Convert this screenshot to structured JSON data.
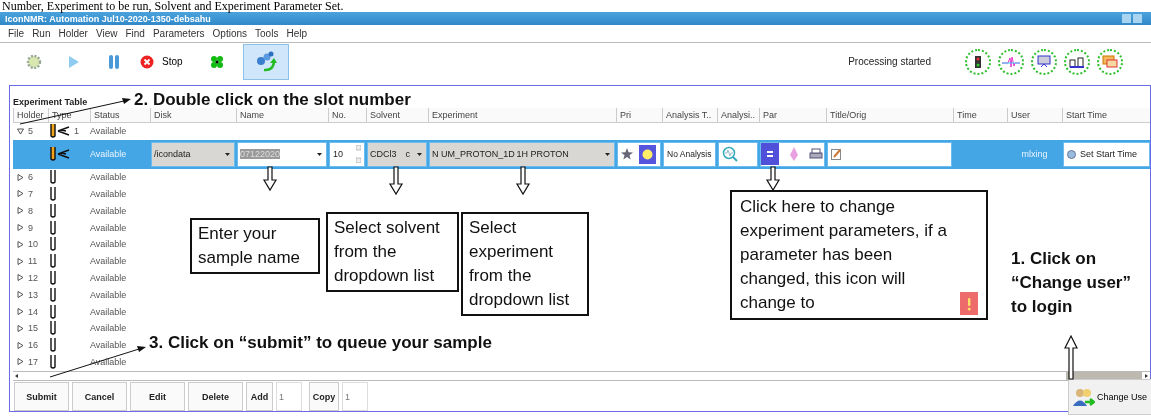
{
  "caption": "Number, Experiment to be run, Solvent and Experiment Parameter Set.",
  "window": {
    "title": "IconNMR: Automation Jul10-2020-1350-debsahu"
  },
  "menu": [
    "File",
    "Run",
    "Holder",
    "View",
    "Find",
    "Parameters",
    "Options",
    "Tools",
    "Help"
  ],
  "toolbar": {
    "stop_label": "Stop",
    "status": "Processing started"
  },
  "table": {
    "title": "Experiment Table",
    "columns": [
      "Holder",
      "Type",
      "Status",
      "Disk",
      "Name",
      "No.",
      "Solvent",
      "Experiment",
      "Pri",
      "Analysis T..",
      "Analysi..",
      "Par",
      "Title/Orig",
      "Time",
      "User",
      "Start Time"
    ],
    "rows": [
      {
        "holder": "5",
        "expanded": true,
        "loaded": true,
        "count": "1",
        "status": "Available"
      },
      {
        "holder": "6",
        "expanded": false,
        "loaded": false,
        "status": "Available"
      },
      {
        "holder": "7",
        "expanded": false,
        "loaded": false,
        "status": "Available"
      },
      {
        "holder": "8",
        "expanded": false,
        "loaded": false,
        "status": "Available"
      },
      {
        "holder": "9",
        "expanded": false,
        "loaded": false,
        "status": "Available"
      },
      {
        "holder": "10",
        "expanded": false,
        "loaded": false,
        "status": "Available"
      },
      {
        "holder": "11",
        "expanded": false,
        "loaded": false,
        "status": "Available"
      },
      {
        "holder": "12",
        "expanded": false,
        "loaded": false,
        "status": "Available"
      },
      {
        "holder": "13",
        "expanded": false,
        "loaded": false,
        "status": "Available"
      },
      {
        "holder": "14",
        "expanded": false,
        "loaded": false,
        "status": "Available"
      },
      {
        "holder": "15",
        "expanded": false,
        "loaded": false,
        "status": "Available"
      },
      {
        "holder": "16",
        "expanded": false,
        "loaded": false,
        "status": "Available"
      },
      {
        "holder": "17",
        "expanded": false,
        "loaded": false,
        "status": "Available"
      }
    ],
    "entry": {
      "status": "Available",
      "disk": "/icondata",
      "name": "07122020",
      "number": "10",
      "solvent": "CDCl3",
      "solvent_code": "c",
      "experiment": "N UM_PROTON_1D",
      "experiment_title": "1H PROTON",
      "analysis": "No Analysis",
      "user": "mlxing",
      "start_time_button": "Set Start Time"
    }
  },
  "buttons": [
    {
      "label": "Submit"
    },
    {
      "label": "Cancel"
    },
    {
      "label": "Edit"
    },
    {
      "label": "Delete"
    }
  ],
  "add": {
    "label": "Add",
    "value": "1"
  },
  "copy": {
    "label": "Copy",
    "value": "1"
  },
  "change_user": "Change Use",
  "annotations": {
    "step2": "2. Double click on the slot number",
    "name_hint": "Enter your sample name",
    "solvent_hint": "Select solvent from the dropdown list",
    "experiment_hint": "Select experiment from the dropdown list",
    "parameter_hint": "Click here to change experiment parameters, if a parameter has been changed, this icon will change to",
    "step1": "1. Click on “Change user” to login",
    "step3": "3. Click on “submit” to queue your sample"
  }
}
